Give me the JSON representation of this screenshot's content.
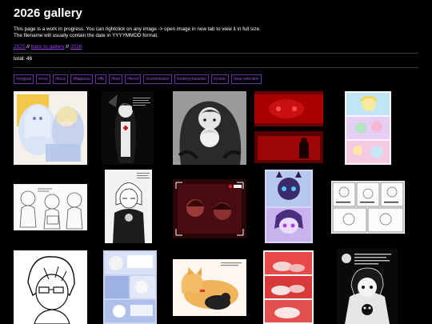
{
  "page": {
    "title": "2026 gallery",
    "intro_line1": "This page is a work in progress. You can rightclick on any image -> open image in new tab to view it in full size.",
    "intro_line2": "The filename will usually contain the date in YYYYMMDD format."
  },
  "nav": {
    "prev": "2025",
    "sep1": " // ",
    "back": "back to gallery",
    "sep2": " // ",
    "current": "2026"
  },
  "total": "total: 46",
  "tags": [
    "#original",
    "#rosc",
    "#bcsc",
    "#flagsona",
    "#ffb",
    "#bsd",
    "#ferret",
    "#commission",
    "#notmycharacter",
    "#comic",
    "clear selection"
  ],
  "thumbnails": [
    "thumb-01",
    "thumb-02",
    "thumb-03",
    "thumb-04",
    "thumb-05",
    "thumb-06",
    "thumb-07",
    "thumb-08",
    "thumb-09",
    "thumb-10",
    "thumb-11",
    "thumb-12",
    "thumb-13",
    "thumb-14",
    "thumb-15"
  ],
  "colors": {
    "background": "#000000",
    "link": "#9a3de0",
    "tag_border": "#6a2ea0",
    "tag_text": "#9a55d8",
    "divider": "#3a3a3a"
  }
}
